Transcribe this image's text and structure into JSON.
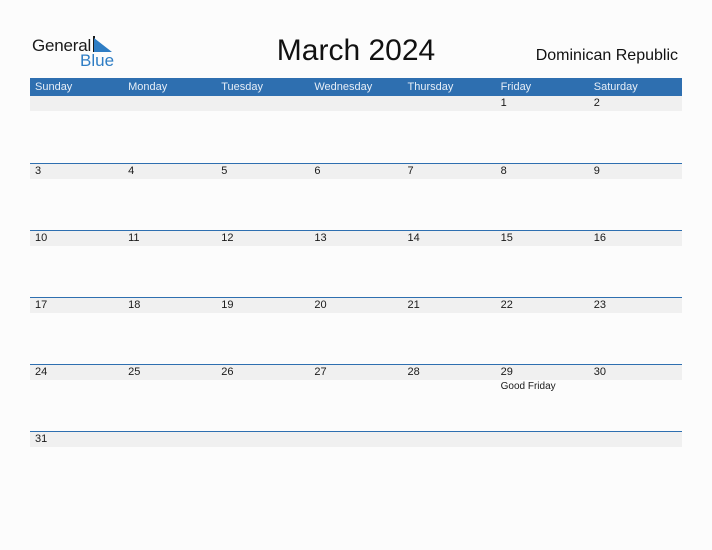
{
  "logo": {
    "line1": "General",
    "line2": "Blue",
    "icon": "triangle-flag-icon"
  },
  "title": "March 2024",
  "country": "Dominican Republic",
  "colors": {
    "header_bg": "#2e6fb0",
    "accent": "#2e7dc4",
    "date_bg": "#f0f0f0"
  },
  "weekdays": [
    "Sunday",
    "Monday",
    "Tuesday",
    "Wednesday",
    "Thursday",
    "Friday",
    "Saturday"
  ],
  "weeks": [
    [
      {
        "day": ""
      },
      {
        "day": ""
      },
      {
        "day": ""
      },
      {
        "day": ""
      },
      {
        "day": ""
      },
      {
        "day": "1"
      },
      {
        "day": "2"
      }
    ],
    [
      {
        "day": "3"
      },
      {
        "day": "4"
      },
      {
        "day": "5"
      },
      {
        "day": "6"
      },
      {
        "day": "7"
      },
      {
        "day": "8"
      },
      {
        "day": "9"
      }
    ],
    [
      {
        "day": "10"
      },
      {
        "day": "11"
      },
      {
        "day": "12"
      },
      {
        "day": "13"
      },
      {
        "day": "14"
      },
      {
        "day": "15"
      },
      {
        "day": "16"
      }
    ],
    [
      {
        "day": "17"
      },
      {
        "day": "18"
      },
      {
        "day": "19"
      },
      {
        "day": "20"
      },
      {
        "day": "21"
      },
      {
        "day": "22"
      },
      {
        "day": "23"
      }
    ],
    [
      {
        "day": "24"
      },
      {
        "day": "25"
      },
      {
        "day": "26"
      },
      {
        "day": "27"
      },
      {
        "day": "28"
      },
      {
        "day": "29",
        "event": "Good Friday"
      },
      {
        "day": "30"
      }
    ],
    [
      {
        "day": "31"
      },
      {
        "day": ""
      },
      {
        "day": ""
      },
      {
        "day": ""
      },
      {
        "day": ""
      },
      {
        "day": ""
      },
      {
        "day": ""
      }
    ]
  ]
}
